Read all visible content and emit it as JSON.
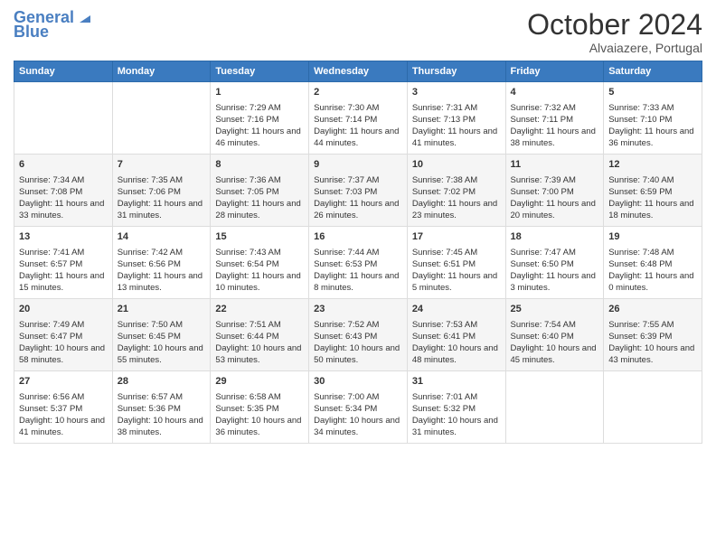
{
  "header": {
    "logo_line1": "General",
    "logo_line2": "Blue",
    "month_title": "October 2024",
    "subtitle": "Alvaiazere, Portugal"
  },
  "weekdays": [
    "Sunday",
    "Monday",
    "Tuesday",
    "Wednesday",
    "Thursday",
    "Friday",
    "Saturday"
  ],
  "weeks": [
    [
      {
        "day": "",
        "info": ""
      },
      {
        "day": "",
        "info": ""
      },
      {
        "day": "1",
        "info": "Sunrise: 7:29 AM\nSunset: 7:16 PM\nDaylight: 11 hours and 46 minutes."
      },
      {
        "day": "2",
        "info": "Sunrise: 7:30 AM\nSunset: 7:14 PM\nDaylight: 11 hours and 44 minutes."
      },
      {
        "day": "3",
        "info": "Sunrise: 7:31 AM\nSunset: 7:13 PM\nDaylight: 11 hours and 41 minutes."
      },
      {
        "day": "4",
        "info": "Sunrise: 7:32 AM\nSunset: 7:11 PM\nDaylight: 11 hours and 38 minutes."
      },
      {
        "day": "5",
        "info": "Sunrise: 7:33 AM\nSunset: 7:10 PM\nDaylight: 11 hours and 36 minutes."
      }
    ],
    [
      {
        "day": "6",
        "info": "Sunrise: 7:34 AM\nSunset: 7:08 PM\nDaylight: 11 hours and 33 minutes."
      },
      {
        "day": "7",
        "info": "Sunrise: 7:35 AM\nSunset: 7:06 PM\nDaylight: 11 hours and 31 minutes."
      },
      {
        "day": "8",
        "info": "Sunrise: 7:36 AM\nSunset: 7:05 PM\nDaylight: 11 hours and 28 minutes."
      },
      {
        "day": "9",
        "info": "Sunrise: 7:37 AM\nSunset: 7:03 PM\nDaylight: 11 hours and 26 minutes."
      },
      {
        "day": "10",
        "info": "Sunrise: 7:38 AM\nSunset: 7:02 PM\nDaylight: 11 hours and 23 minutes."
      },
      {
        "day": "11",
        "info": "Sunrise: 7:39 AM\nSunset: 7:00 PM\nDaylight: 11 hours and 20 minutes."
      },
      {
        "day": "12",
        "info": "Sunrise: 7:40 AM\nSunset: 6:59 PM\nDaylight: 11 hours and 18 minutes."
      }
    ],
    [
      {
        "day": "13",
        "info": "Sunrise: 7:41 AM\nSunset: 6:57 PM\nDaylight: 11 hours and 15 minutes."
      },
      {
        "day": "14",
        "info": "Sunrise: 7:42 AM\nSunset: 6:56 PM\nDaylight: 11 hours and 13 minutes."
      },
      {
        "day": "15",
        "info": "Sunrise: 7:43 AM\nSunset: 6:54 PM\nDaylight: 11 hours and 10 minutes."
      },
      {
        "day": "16",
        "info": "Sunrise: 7:44 AM\nSunset: 6:53 PM\nDaylight: 11 hours and 8 minutes."
      },
      {
        "day": "17",
        "info": "Sunrise: 7:45 AM\nSunset: 6:51 PM\nDaylight: 11 hours and 5 minutes."
      },
      {
        "day": "18",
        "info": "Sunrise: 7:47 AM\nSunset: 6:50 PM\nDaylight: 11 hours and 3 minutes."
      },
      {
        "day": "19",
        "info": "Sunrise: 7:48 AM\nSunset: 6:48 PM\nDaylight: 11 hours and 0 minutes."
      }
    ],
    [
      {
        "day": "20",
        "info": "Sunrise: 7:49 AM\nSunset: 6:47 PM\nDaylight: 10 hours and 58 minutes."
      },
      {
        "day": "21",
        "info": "Sunrise: 7:50 AM\nSunset: 6:45 PM\nDaylight: 10 hours and 55 minutes."
      },
      {
        "day": "22",
        "info": "Sunrise: 7:51 AM\nSunset: 6:44 PM\nDaylight: 10 hours and 53 minutes."
      },
      {
        "day": "23",
        "info": "Sunrise: 7:52 AM\nSunset: 6:43 PM\nDaylight: 10 hours and 50 minutes."
      },
      {
        "day": "24",
        "info": "Sunrise: 7:53 AM\nSunset: 6:41 PM\nDaylight: 10 hours and 48 minutes."
      },
      {
        "day": "25",
        "info": "Sunrise: 7:54 AM\nSunset: 6:40 PM\nDaylight: 10 hours and 45 minutes."
      },
      {
        "day": "26",
        "info": "Sunrise: 7:55 AM\nSunset: 6:39 PM\nDaylight: 10 hours and 43 minutes."
      }
    ],
    [
      {
        "day": "27",
        "info": "Sunrise: 6:56 AM\nSunset: 5:37 PM\nDaylight: 10 hours and 41 minutes."
      },
      {
        "day": "28",
        "info": "Sunrise: 6:57 AM\nSunset: 5:36 PM\nDaylight: 10 hours and 38 minutes."
      },
      {
        "day": "29",
        "info": "Sunrise: 6:58 AM\nSunset: 5:35 PM\nDaylight: 10 hours and 36 minutes."
      },
      {
        "day": "30",
        "info": "Sunrise: 7:00 AM\nSunset: 5:34 PM\nDaylight: 10 hours and 34 minutes."
      },
      {
        "day": "31",
        "info": "Sunrise: 7:01 AM\nSunset: 5:32 PM\nDaylight: 10 hours and 31 minutes."
      },
      {
        "day": "",
        "info": ""
      },
      {
        "day": "",
        "info": ""
      }
    ]
  ]
}
